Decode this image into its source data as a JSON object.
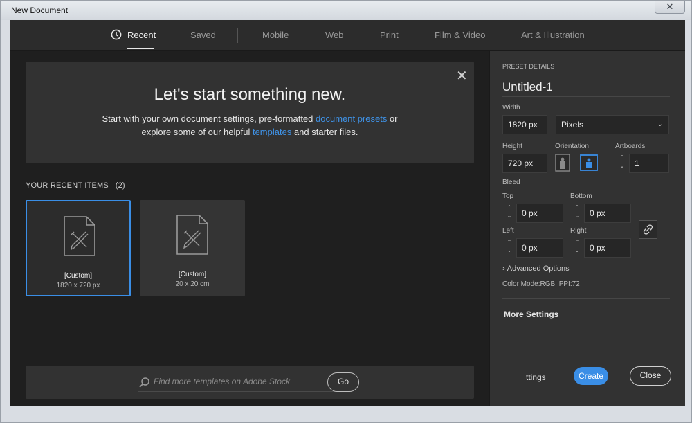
{
  "window": {
    "title": "New Document",
    "close_glyph": "✕"
  },
  "tabs": [
    {
      "label": "Recent",
      "icon": "clock-icon",
      "active": true
    },
    {
      "label": "Saved"
    },
    {
      "label": "Mobile"
    },
    {
      "label": "Web"
    },
    {
      "label": "Print"
    },
    {
      "label": "Film & Video"
    },
    {
      "label": "Art & Illustration"
    }
  ],
  "welcome": {
    "heading": "Let's start something new.",
    "line1_a": "Start with your own document settings, pre-formatted ",
    "line1_link": "document presets",
    "line1_b": " or",
    "line2_a": "explore some of our helpful ",
    "line2_link": "templates",
    "line2_b": " and starter files.",
    "close_glyph": "✕"
  },
  "recent": {
    "label": "YOUR RECENT ITEMS",
    "count": "(2)",
    "items": [
      {
        "name": "[Custom]",
        "dims": "1820 x 720 px",
        "selected": true
      },
      {
        "name": "[Custom]",
        "dims": "20 x 20 cm",
        "selected": false
      }
    ]
  },
  "search": {
    "placeholder": "Find more templates on Adobe Stock",
    "go_label": "Go"
  },
  "preset": {
    "section_label": "PRESET DETAILS",
    "name": "Untitled-1",
    "width_label": "Width",
    "width_value": "1820 px",
    "units": "Pixels",
    "height_label": "Height",
    "height_value": "720 px",
    "orientation_label": "Orientation",
    "artboards_label": "Artboards",
    "artboards_value": "1",
    "bleed_label": "Bleed",
    "top_label": "Top",
    "top_value": "0 px",
    "bottom_label": "Bottom",
    "bottom_value": "0 px",
    "left_label": "Left",
    "left_value": "0 px",
    "right_label": "Right",
    "right_value": "0 px",
    "advanced_label": "Advanced Options",
    "color_mode": "Color Mode:RGB, PPI:72",
    "more_settings": "More Settings"
  },
  "footer": {
    "settings_label": "ttings",
    "create_label": "Create",
    "close_label": "Close"
  },
  "colors": {
    "accent": "#3a8ee6",
    "link": "#3f93e8"
  }
}
